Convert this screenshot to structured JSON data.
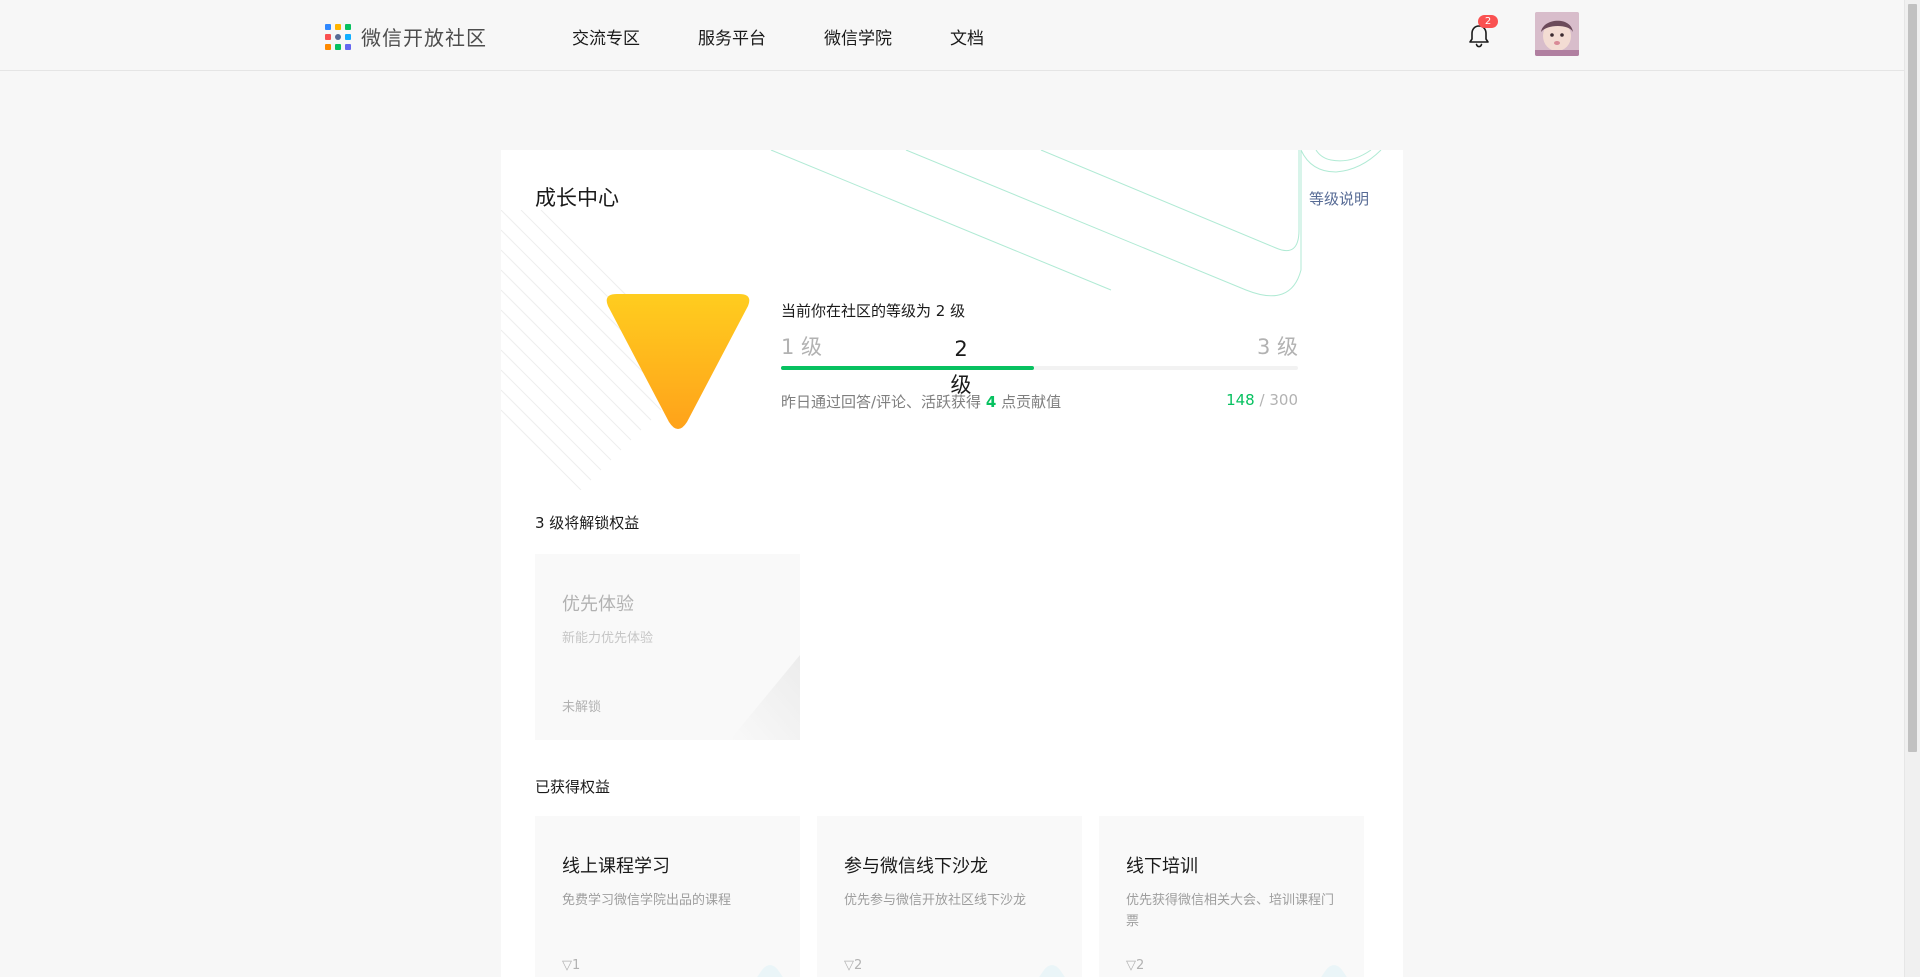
{
  "header": {
    "site_title": "微信开放社区",
    "nav": [
      "交流专区",
      "服务平台",
      "微信学院",
      "文档"
    ],
    "notification_count": "2",
    "logo_colors": [
      "#2f88ff",
      "#ffb400",
      "#07c160",
      "#fa5151",
      "#576b95",
      "#10aeff",
      "#ff8a00",
      "#07c160",
      "#6467f0"
    ]
  },
  "growth": {
    "title": "成长中心",
    "level_help": "等级说明",
    "current_level_text": "当前你在社区的等级为 2 级",
    "level_start": "1 级",
    "level_current": "2 级",
    "level_end": "3 级",
    "progress_fraction": 0.49,
    "contrib_prefix": "昨日通过回答/评论、活跃获得",
    "contrib_points": "4",
    "contrib_suffix": "点贡献值",
    "score_current": "148",
    "score_sep": "/",
    "score_total": "300"
  },
  "unlock_section": {
    "title": "3 级将解锁权益",
    "perks": [
      {
        "name": "优先体验",
        "desc": "新能力优先体验",
        "status": "未解锁"
      }
    ]
  },
  "earned_section": {
    "title": "已获得权益",
    "perks": [
      {
        "name": "线上课程学习",
        "desc": "免费学习微信学院出品的课程",
        "level_tag": "▽1"
      },
      {
        "name": "参与微信线下沙龙",
        "desc": "优先参与微信开放社区线下沙龙",
        "level_tag": "▽2"
      },
      {
        "name": "线下培训",
        "desc": "优先获得微信相关大会、培训课程门票",
        "level_tag": "▽2"
      }
    ]
  },
  "colors": {
    "accent_green": "#07c160",
    "link_blue": "#576b95",
    "badge_top": "#ffcd1f",
    "badge_bottom": "#ffa21a"
  }
}
